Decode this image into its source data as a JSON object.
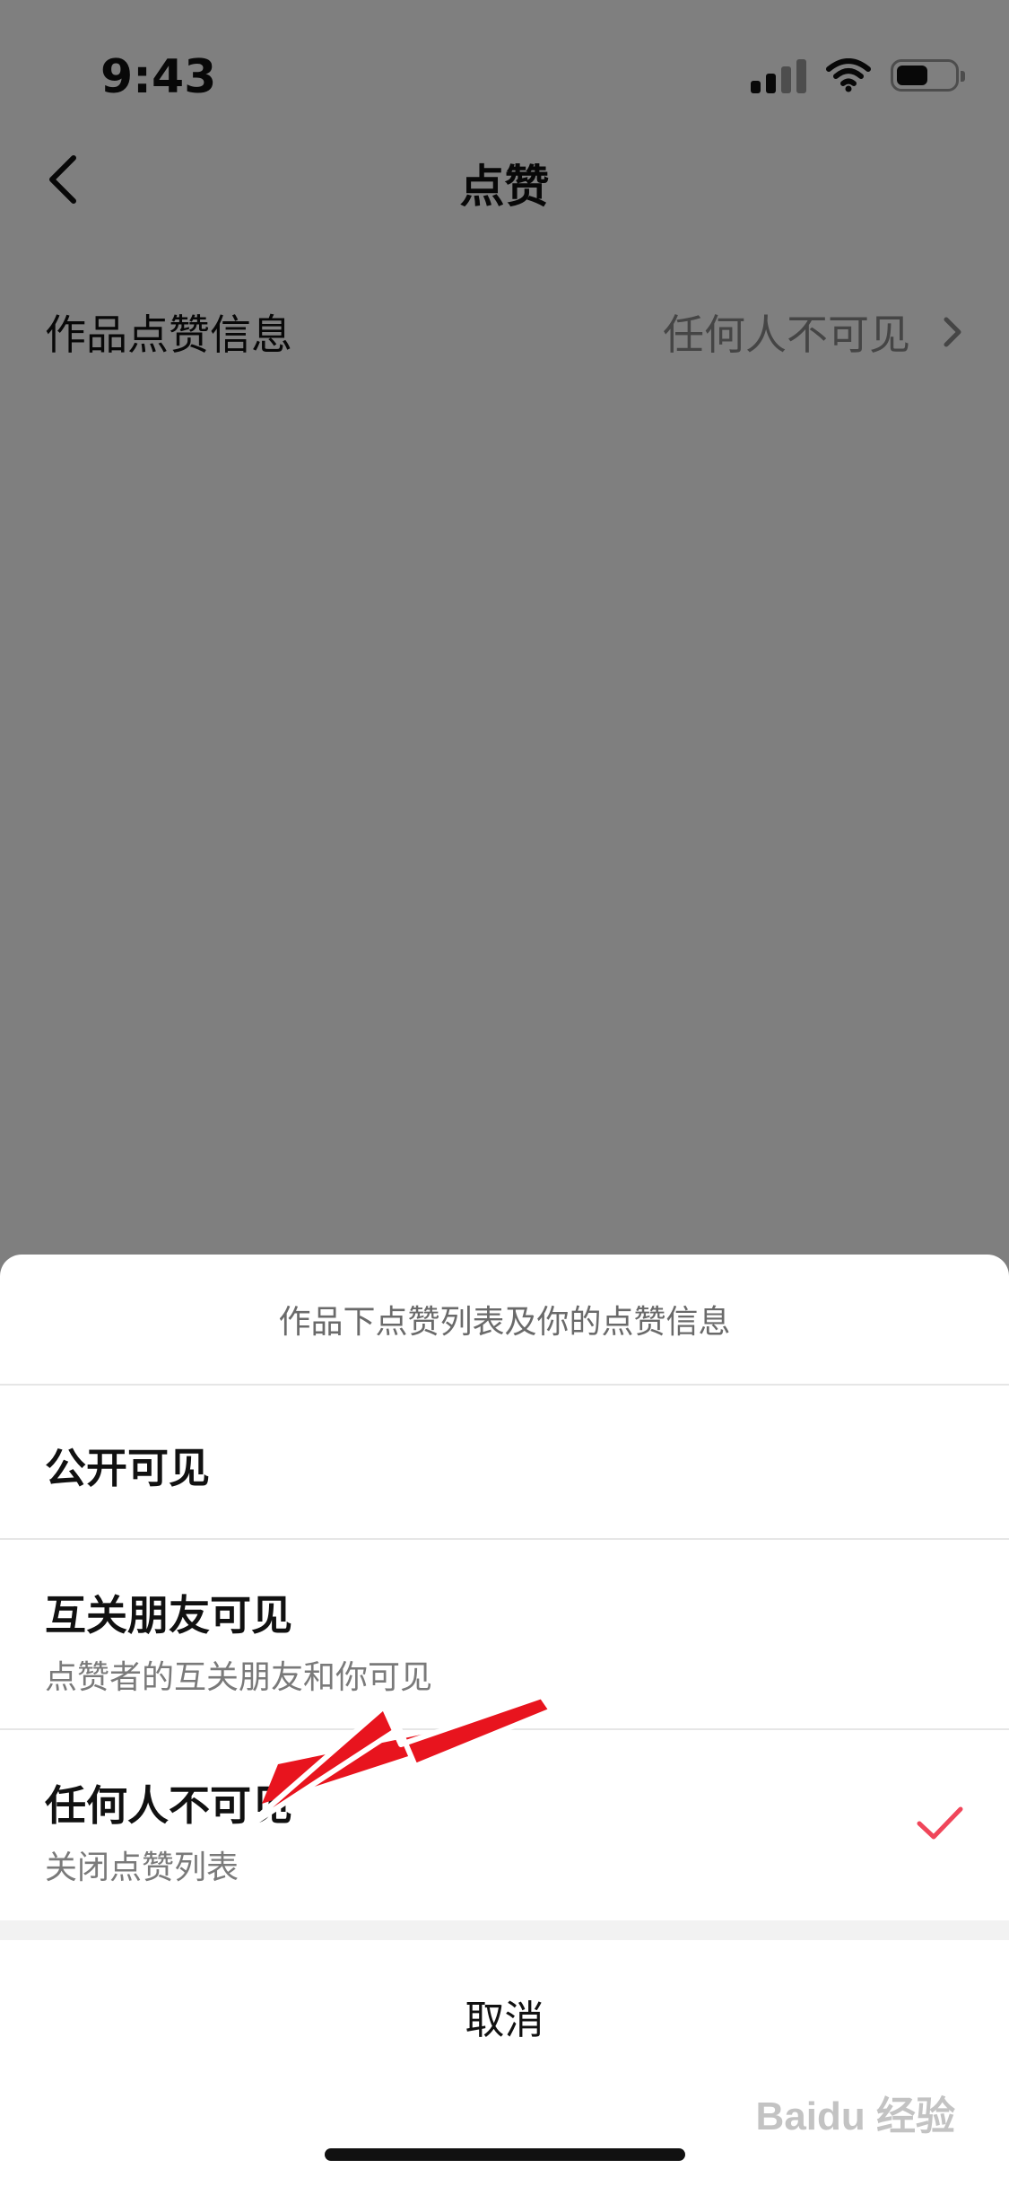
{
  "status_bar": {
    "time": "9:43"
  },
  "nav": {
    "title": "点赞",
    "back_icon": "chevron-left-icon"
  },
  "setting": {
    "label": "作品点赞信息",
    "value": "任何人不可见",
    "chevron_icon": "chevron-right-icon"
  },
  "sheet": {
    "header": "作品下点赞列表及你的点赞信息",
    "options": [
      {
        "title": "公开可见",
        "subtitle": "",
        "selected": false
      },
      {
        "title": "互关朋友可见",
        "subtitle": "点赞者的互关朋友和你可见",
        "selected": false
      },
      {
        "title": "任何人不可见",
        "subtitle": "关闭点赞列表",
        "selected": true
      }
    ],
    "cancel": "取消"
  },
  "colors": {
    "accent_check": "#f0465a",
    "annotation_arrow": "#e8141e"
  },
  "watermark": "Baidu 经验"
}
